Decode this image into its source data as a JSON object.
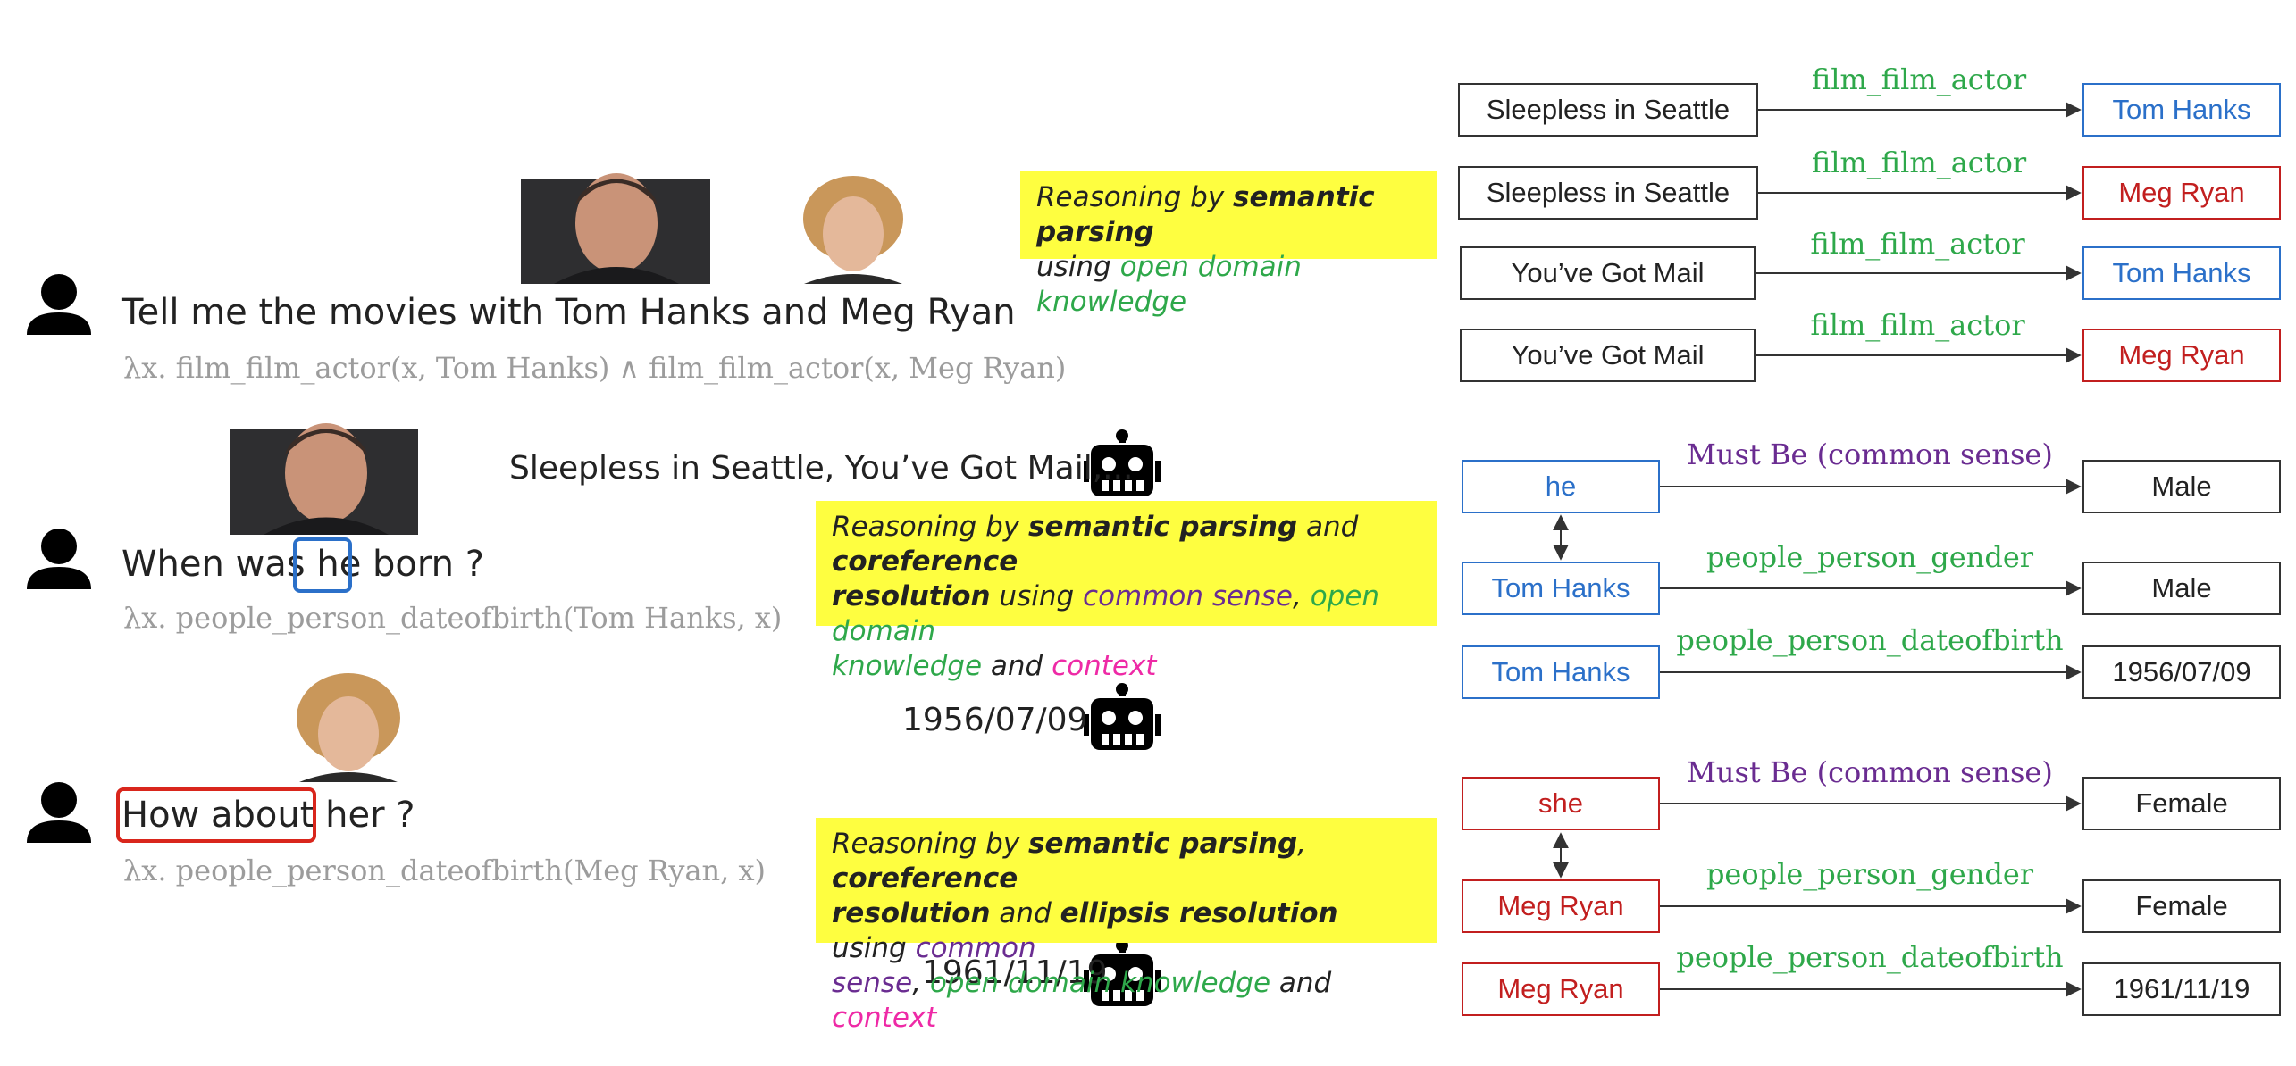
{
  "dialogue": {
    "turn1": {
      "utterance": "Tell me the movies with Tom Hanks and Meg Ryan",
      "logical_form": "λx. film_film_actor(x, Tom Hanks) ∧ film_film_actor(x, Meg Ryan)",
      "answer": "Sleepless in Seattle, You’ve Got Mail,..."
    },
    "turn2": {
      "utterance_before": "When was ",
      "utterance_highlight": "he",
      "utterance_after": " born ?",
      "logical_form": "λx. people_person_dateofbirth(Tom Hanks, x)",
      "answer": "1956/07/09"
    },
    "turn3": {
      "utterance_highlight": "How about",
      "utterance_after": " her ?",
      "logical_form": "λx. people_person_dateofbirth(Meg Ryan, x)",
      "answer": "1961/11/19"
    }
  },
  "notes": {
    "note1": {
      "l1_a": "Reasoning by ",
      "l1_b": "semantic parsing",
      "l2_a": "using ",
      "l2_b": "open domain knowledge"
    },
    "note2": {
      "l1_a": "Reasoning by ",
      "l1_b": "semantic parsing",
      "l1_c": " and ",
      "l1_d": "coreference",
      "l2_a": "resolution",
      "l2_b": " using ",
      "l2_c": "common sense",
      "l2_d": ", ",
      "l2_e": "open domain",
      "l3_a": "knowledge",
      "l3_b": " and ",
      "l3_c": "context"
    },
    "note3": {
      "l1_a": "Reasoning by ",
      "l1_b": "semantic parsing",
      "l1_c": ", ",
      "l1_d": "coreference",
      "l2_a": "resolution",
      "l2_b": " and ",
      "l2_c": "ellipsis resolution",
      "l2_d": " using ",
      "l2_e": "common",
      "l3_a": "sense",
      "l3_b": ", ",
      "l3_c": "open domain knowledge",
      "l3_d": " and ",
      "l3_e": "context"
    }
  },
  "graph": {
    "triples": [
      {
        "head": "Sleepless in Seattle",
        "relation": "film_film_actor",
        "tail": "Tom Hanks"
      },
      {
        "head": "Sleepless in Seattle",
        "relation": "film_film_actor",
        "tail": "Meg Ryan"
      },
      {
        "head": "You’ve Got Mail",
        "relation": "film_film_actor",
        "tail": "Tom Hanks"
      },
      {
        "head": "You’ve Got Mail",
        "relation": "film_film_actor",
        "tail": "Meg Ryan"
      },
      {
        "head": "he",
        "relation": "Must Be (common sense)",
        "tail": "Male"
      },
      {
        "head": "Tom Hanks",
        "relation": "people_person_gender",
        "tail": "Male"
      },
      {
        "head": "Tom Hanks",
        "relation": "people_person_dateofbirth",
        "tail": "1956/07/09"
      },
      {
        "head": "she",
        "relation": "Must Be (common sense)",
        "tail": "Female"
      },
      {
        "head": "Meg Ryan",
        "relation": "people_person_gender",
        "tail": "Female"
      },
      {
        "head": "Meg Ryan",
        "relation": "people_person_dateofbirth",
        "tail": "1961/11/19"
      }
    ]
  },
  "colors": {
    "tom_hanks": "#2b70c9",
    "meg_ryan": "#c21f1f",
    "relation_kb": "#2ea84a",
    "relation_common_sense": "#6a2c91",
    "context": "#ee2aa6",
    "note_background": "#fefe40"
  },
  "icons": {
    "user": "person-silhouette-icon",
    "system": "robot-icon"
  }
}
